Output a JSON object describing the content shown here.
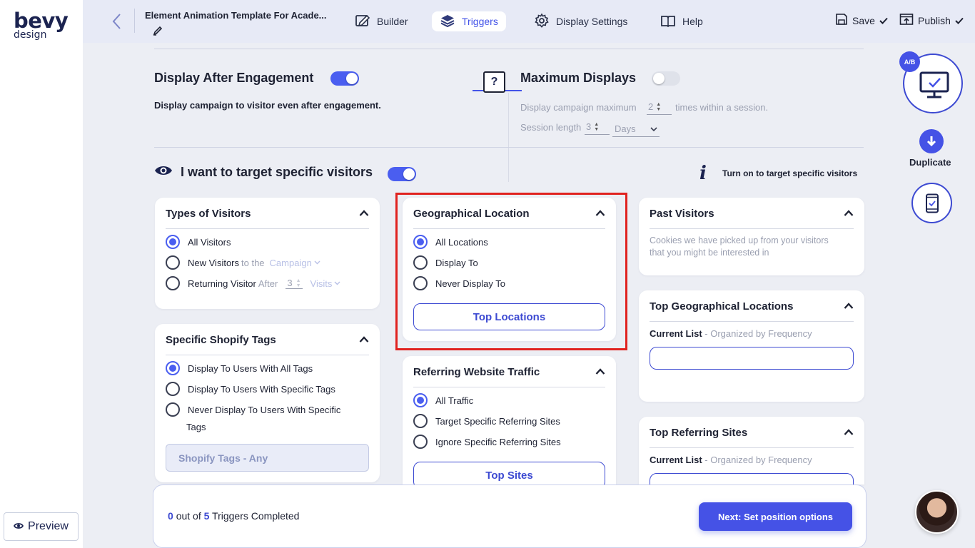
{
  "sidebar": {
    "logo_line1": "bevy",
    "logo_line2": "design",
    "preview_label": "Preview"
  },
  "header": {
    "title": "Element Animation Template For Acade...",
    "nav": [
      {
        "label": "Builder",
        "icon": "builder-icon"
      },
      {
        "label": "Triggers",
        "icon": "layers-icon",
        "active": true
      },
      {
        "label": "Display Settings",
        "icon": "gear-icon"
      },
      {
        "label": "Help",
        "icon": "book-icon"
      }
    ],
    "save_label": "Save",
    "publish_label": "Publish"
  },
  "engagement": {
    "title": "Display After Engagement",
    "enabled": true,
    "description": "Display campaign to visitor even after engagement.",
    "help_label": "?"
  },
  "max_displays": {
    "title": "Maximum Displays",
    "enabled": false,
    "line1_prefix": "Display campaign maximum",
    "line1_value": "2",
    "line1_suffix": "times within a session.",
    "line2_prefix": "Session length",
    "line2_value": "3",
    "unit": "Days"
  },
  "targeting": {
    "title": "I want to target specific visitors",
    "enabled": true,
    "info_text": "Turn on to target specific visitors",
    "info_glyph": "i"
  },
  "visitors_card": {
    "title": "Types of Visitors",
    "options": [
      {
        "label": "All Visitors",
        "selected": true
      },
      {
        "label": "New Visitors",
        "suffix": "to the",
        "select": "Campaign"
      },
      {
        "label": "Returning Visitor",
        "suffix": "After",
        "value": "3",
        "unit": "Visits"
      }
    ]
  },
  "shopify_card": {
    "title": "Specific Shopify Tags",
    "options": [
      {
        "label": "Display To Users With All Tags",
        "selected": true
      },
      {
        "label": "Display To Users With Specific Tags"
      },
      {
        "label": "Never Display To Users With Specific",
        "line2": "Tags"
      }
    ],
    "field": "Shopify Tags - Any"
  },
  "geo_card": {
    "title": "Geographical Location",
    "options": [
      {
        "label": "All Locations",
        "selected": true
      },
      {
        "label": "Display To"
      },
      {
        "label": "Never Display To"
      }
    ],
    "button": "Top Locations"
  },
  "referring_card": {
    "title": "Referring Website Traffic",
    "options": [
      {
        "label": "All Traffic",
        "selected": true
      },
      {
        "label": "Target Specific Referring Sites"
      },
      {
        "label": "Ignore Specific Referring Sites"
      }
    ],
    "button": "Top Sites"
  },
  "past_card": {
    "title": "Past Visitors",
    "description": "Cookies we have picked up from your visitors that you might be interested in"
  },
  "top_geo_card": {
    "title": "Top Geographical Locations",
    "list_label": "Current List",
    "list_suffix": "- Organized by Frequency"
  },
  "top_ref_card": {
    "title": "Top Referring Sites",
    "list_label": "Current List",
    "list_suffix": "- Organized by Frequency"
  },
  "footer": {
    "completed": "0",
    "middle": "out of",
    "total": "5",
    "suffix": "Triggers Completed",
    "next_label": "Next: Set position options"
  },
  "right_rail": {
    "ab_label": "A/B",
    "duplicate_label": "Duplicate"
  },
  "colors": {
    "accent": "#4552e6",
    "highlight": "#e0221f"
  }
}
